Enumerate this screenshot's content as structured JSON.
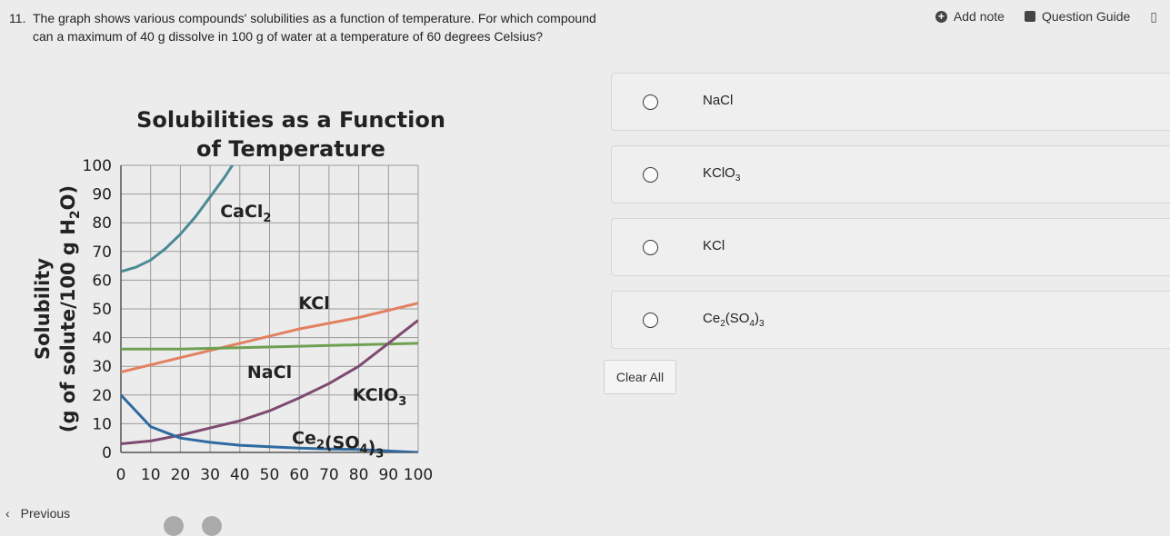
{
  "toolbar": {
    "add_note": "Add note",
    "question_guide": "Question Guide"
  },
  "question": {
    "number": "11.",
    "text": "The graph shows various compounds' solubilities as a function of temperature. For which compound can a maximum of 40 g dissolve in 100 g of water at a temperature of 60 degrees Celsius?"
  },
  "options": [
    {
      "label": "NaCl"
    },
    {
      "label": "KClO",
      "sub": "3"
    },
    {
      "label": "KCl"
    },
    {
      "label": "Ce",
      "sub": "2",
      "mid": "(SO",
      "sub2": "4",
      "end": ")",
      "sub3": "3"
    }
  ],
  "clear_all": "Clear All",
  "nav": {
    "previous": "Previous"
  },
  "chart_data": {
    "type": "line",
    "title": "Solubilities as a Function of Temperature",
    "xlabel": "",
    "ylabel": "Solubility (g of solute/100 g H2O)",
    "xlim": [
      0,
      100
    ],
    "ylim": [
      0,
      100
    ],
    "x_ticks": [
      0,
      10,
      20,
      30,
      40,
      50,
      60,
      70,
      80,
      90,
      100
    ],
    "y_ticks": [
      0,
      10,
      20,
      30,
      40,
      50,
      60,
      70,
      80,
      90,
      100
    ],
    "grid": true,
    "series": [
      {
        "name": "CaCl2",
        "color": "#4a8a95",
        "x": [
          0,
          5,
          10,
          15,
          20,
          25,
          30,
          35,
          40
        ],
        "y": [
          63,
          64.5,
          67,
          71,
          76,
          82,
          89,
          96,
          104
        ]
      },
      {
        "name": "KCl",
        "color": "#e28060",
        "x": [
          0,
          20,
          40,
          60,
          80,
          100
        ],
        "y": [
          28,
          33,
          38,
          43,
          47,
          52
        ]
      },
      {
        "name": "NaCl",
        "color": "#6fa052",
        "x": [
          0,
          20,
          40,
          60,
          80,
          100
        ],
        "y": [
          36,
          36,
          36.5,
          37,
          37.5,
          38
        ]
      },
      {
        "name": "KClO3",
        "color": "#7e4a70",
        "x": [
          0,
          10,
          20,
          30,
          40,
          50,
          60,
          70,
          80,
          90,
          100
        ],
        "y": [
          3,
          4,
          6,
          8.5,
          11,
          14.5,
          19,
          24,
          30,
          38,
          46
        ]
      },
      {
        "name": "Ce2(SO4)3",
        "color": "#2f6aa0",
        "x": [
          0,
          10,
          20,
          30,
          40,
          50,
          60,
          70,
          80,
          90,
          100
        ],
        "y": [
          20,
          9,
          5,
          3.5,
          2.5,
          2,
          1.5,
          1.2,
          1,
          0.5,
          0
        ]
      }
    ],
    "labels": [
      {
        "text": "CaCl",
        "sub": "2",
        "x": 42,
        "y": 82
      },
      {
        "text": "KCl",
        "sub": "",
        "x": 65,
        "y": 50
      },
      {
        "text": "NaCl",
        "sub": "",
        "x": 50,
        "y": 26
      },
      {
        "text": "KClO",
        "sub": "3",
        "x": 87,
        "y": 18
      },
      {
        "text": "Ce",
        "sub": "2",
        "mid": "(SO",
        "sub2": "4",
        "end": ")",
        "sub3": "3",
        "x": 73,
        "y": 3
      }
    ]
  }
}
